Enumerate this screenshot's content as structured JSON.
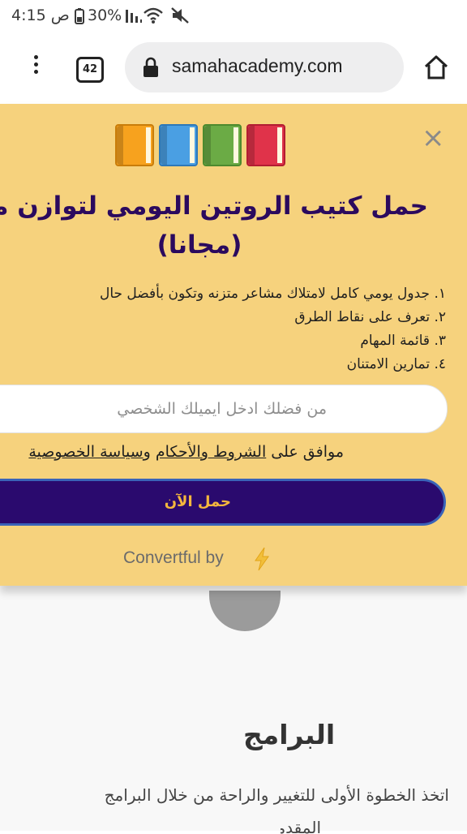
{
  "status_bar": {
    "left_text": "ص 4:15",
    "battery": "30%",
    "icons": [
      "battery-icon",
      "signal-icon",
      "wifi-icon",
      "mute-icon"
    ]
  },
  "browser": {
    "tab_count": "42",
    "url": "samahacademy.com",
    "icons": [
      "menu-dots-icon",
      "lock-icon",
      "home-icon"
    ]
  },
  "popup": {
    "close_icon": "close-icon",
    "books": [
      "orange-book",
      "blue-book",
      "green-book",
      "red-book"
    ],
    "title_line1": "حمل كتيب الروتين اليومي لتوازن مشاعرك",
    "title_line2": "(مجانا)",
    "list": [
      "١. جدول يومي كامل لامتلاك مشاعر متزنه وتكون بأفضل حال",
      "٢. تعرف على نقاط الطرق",
      "٣. قائمة المهام",
      "٤. تمارين الامتنان"
    ],
    "email_placeholder": "من فضلك ادخل ايميلك الشخصي",
    "consent_prefix": "موافق على ",
    "terms_link": "الشروط والأحكام",
    "consent_and": " و",
    "privacy_link": "سياسة الخصوصية",
    "cta_label": "حمل الآن",
    "powered_by": "Convertful by"
  },
  "page": {
    "heading": "البرامج",
    "paragraph": "اتخذ الخطوة الأولى للتغيير والراحة من خلال البرامج",
    "paragraph2": "المقدمة"
  },
  "colors": {
    "popup_bg": "#f6d27d",
    "title": "#2b0a5e",
    "cta_bg": "#2a0a6e",
    "cta_text": "#f4b73d"
  }
}
